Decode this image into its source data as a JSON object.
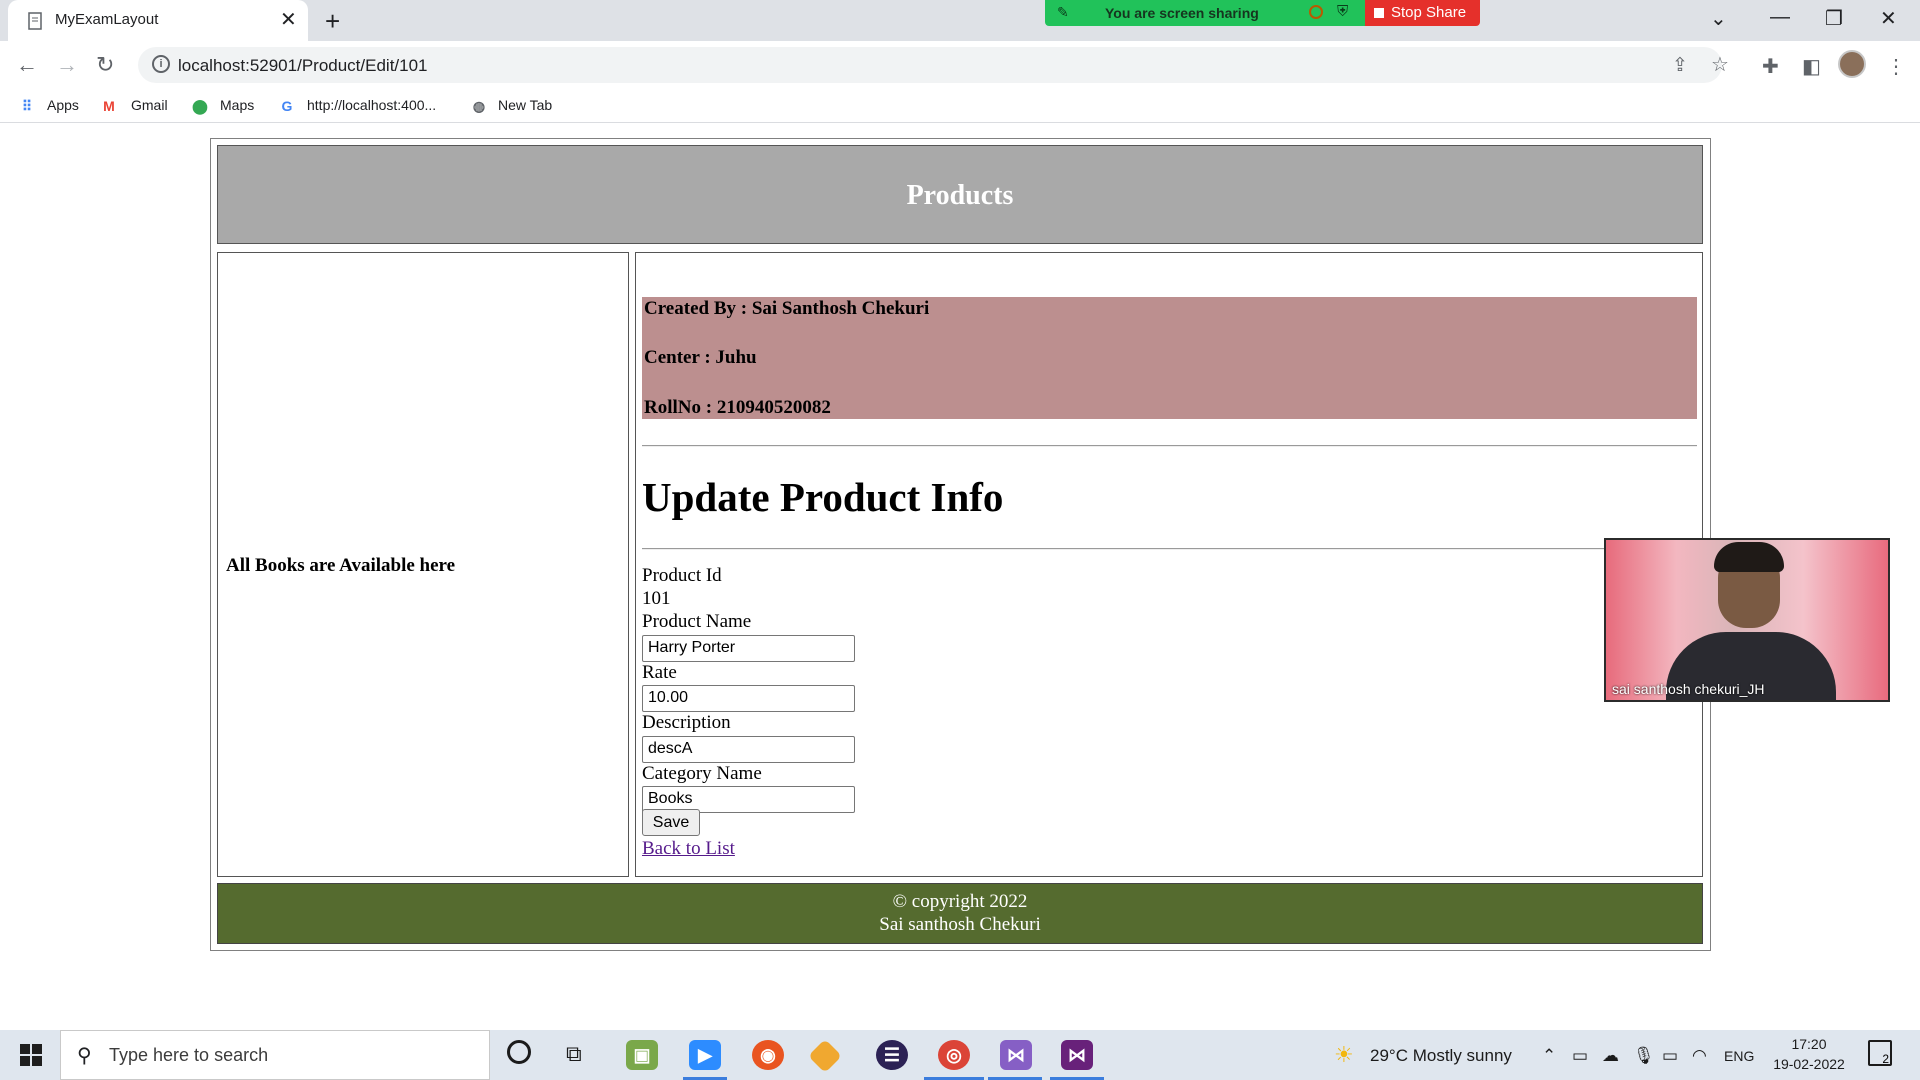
{
  "browser": {
    "tab_title": "MyExamLayout",
    "url": "localhost:52901/Product/Edit/101",
    "sharing_text": "You are screen sharing",
    "stop_share_label": "Stop Share"
  },
  "bookmarks": [
    {
      "label": "Apps"
    },
    {
      "label": "Gmail"
    },
    {
      "label": "Maps"
    },
    {
      "label": "http://localhost:400..."
    },
    {
      "label": "New Tab"
    }
  ],
  "page": {
    "header_title": "Products",
    "sidebar_text": "All Books are Available here",
    "created_by": "Created By : Sai Santhosh Chekuri",
    "center": "Center : Juhu",
    "rollno": "RollNo : 210940520082",
    "heading": "Update Product Info",
    "form": {
      "product_id_label": "Product Id",
      "product_id_value": "101",
      "product_name_label": "Product Name",
      "product_name_value": "Harry Porter",
      "rate_label": "Rate",
      "rate_value": "10.00",
      "description_label": "Description",
      "description_value": "descA",
      "category_label": "Category Name",
      "category_value": "Books",
      "save_label": "Save",
      "back_link": "Back to List"
    },
    "footer_line1": "© copyright 2022",
    "footer_line2": "Sai santhosh Chekuri"
  },
  "video": {
    "participant_name": "sai santhosh chekuri_JH"
  },
  "taskbar": {
    "search_placeholder": "Type here to search",
    "weather": "29°C  Mostly sunny",
    "language": "ENG",
    "time": "17:20",
    "date": "19-02-2022",
    "notification_count": "2"
  },
  "colors": {
    "header_bg": "#a9a9a9",
    "creator_bg": "#bc8f8f",
    "footer_bg": "#556b2f",
    "share_green": "#21c25a",
    "stop_red": "#e5302b"
  }
}
